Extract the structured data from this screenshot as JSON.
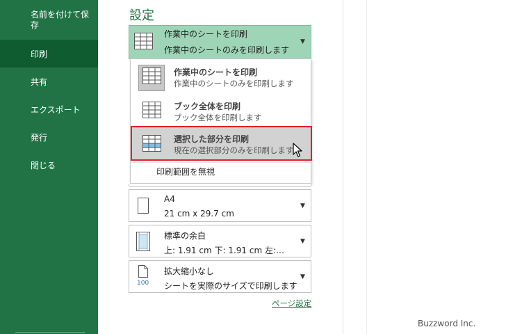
{
  "sidebar": {
    "items": [
      {
        "label": "名前を付けて保存"
      },
      {
        "label": "印刷"
      },
      {
        "label": "共有"
      },
      {
        "label": "エクスポート"
      },
      {
        "label": "発行"
      },
      {
        "label": "閉じる"
      }
    ],
    "active_index": 1
  },
  "settings": {
    "title": "設定",
    "print_what": {
      "title": "作業中のシートを印刷",
      "subtitle": "作業中のシートのみを印刷します"
    },
    "menu": {
      "items": [
        {
          "title": "作業中のシートを印刷",
          "subtitle": "作業中のシートのみを印刷します"
        },
        {
          "title": "ブック全体を印刷",
          "subtitle": "ブック全体を印刷します"
        },
        {
          "title": "選択した部分を印刷",
          "subtitle": "現在の選択部分のみを印刷します"
        }
      ],
      "footer": "印刷範囲を無視"
    },
    "paper": {
      "title": "A4",
      "subtitle": "21 cm x 29.7 cm"
    },
    "margins": {
      "title": "標準の余白",
      "subtitle": "上: 1.91 cm 下: 1.91 cm 左:…"
    },
    "scaling": {
      "title": "拡大縮小なし",
      "subtitle": "シートを実際のサイズで印刷します",
      "icon_text": "100"
    },
    "page_setup_link": "ページ設定"
  },
  "watermark": "Buzzword Inc.",
  "colors": {
    "accent": "#217346",
    "sidebar_active": "#0e5c2f",
    "selected_bg": "#9fd5b7",
    "highlight_border": "#e0202a"
  }
}
